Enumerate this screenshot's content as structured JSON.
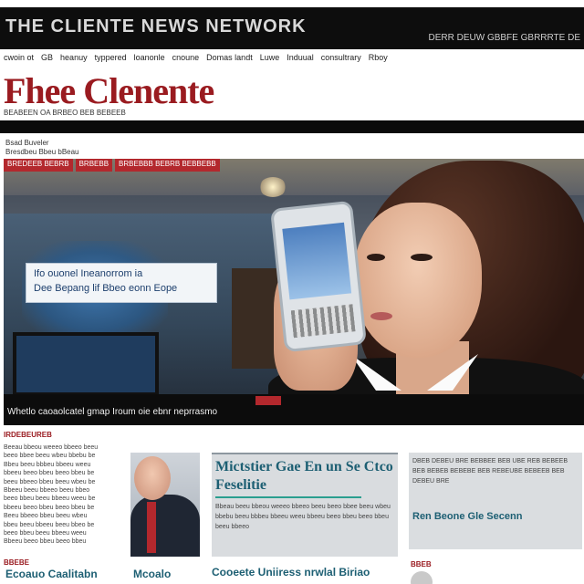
{
  "topbar": {
    "title": "THE CLIENTE NEWS NETWORK",
    "right_text": "DERR DEUW GBBFE GBRRRTE DE"
  },
  "nav": {
    "items": [
      "cwoin ot",
      "GB",
      "heanuy",
      "typpered",
      "loanonle",
      "cnoune",
      "Domas landt",
      "Luwe",
      "Induual",
      "consultrary",
      "Rboy"
    ]
  },
  "masthead": {
    "title": "Fhee Clenente",
    "subtitle": "BEABEEN OA BRBEO BEB BEBEEB"
  },
  "breadcrumb": {
    "line1": "Bsad Buveler",
    "line2": "Bresdbeu Bbeu bBeau"
  },
  "hero": {
    "badges": [
      "BREDEEB BEBRB",
      "BRBEBB",
      "BRBEBBB BEBRB BEBBEBB"
    ],
    "overlay_line1": "Ifo ouonel Ineanorrom ia",
    "overlay_line2": "Dee Bepang lif Bbeo eonn Eope",
    "caption": "Whetlo caoaolcatel gmap Iroum oie ebnr neprrasmo"
  },
  "section": {
    "label": "IRDEBEUREB",
    "col1_lines": [
      "Beeau bbeou weeeo bbeeo beeu",
      "beeo bbee beeu wbeu bbebu be",
      "Bbeu beeu bbbeu bbeeu weeu",
      "bbeeu beeo bbeu beeo bbeu be",
      "beeu bbeeo bbeu beeu wbeu be",
      "Bbeeu beeu bbeeo beeu bbeo",
      "beeo bbeu beeu bbeeu weeu be",
      "bbeeu beeo bbeu beeo bbeu be",
      "Beeu bbeeo bbeu beeu wbeu",
      "bbeu beeu bbeeu beeu bbeo be",
      "beeo bbeu beeu bbeeu weeu",
      "Bbeeu beeo bbeu beeo bbeu"
    ]
  },
  "card2": {
    "title": "Mictstier Gae En un Se Ctco Feselitie",
    "body": "Bbeau beeu bbeou weeeo bbeeo beeu beeo bbee beeu wbeu bbebu beeu bbbeu bbeeu weeu bbeeu beeo bbeu beeo bbeu beeu bbeeo"
  },
  "card3": {
    "body": "DBEB DEBEU BRE BEBBEE BEB UBE REB BEBEEB BEB BEBEB BEBEBE BEB REBEUBE BEBEEB BEB DEBEU BRE",
    "headline": "Ren Beone Gle Secenn"
  },
  "bottom": {
    "tag1": "BBEBE",
    "headline1": "Ecoauo Caalitabn",
    "headline2": "Mcoalo",
    "headline3": "Cooeete Uniiress nrwlal Biriao",
    "tag3": "BBEB"
  }
}
